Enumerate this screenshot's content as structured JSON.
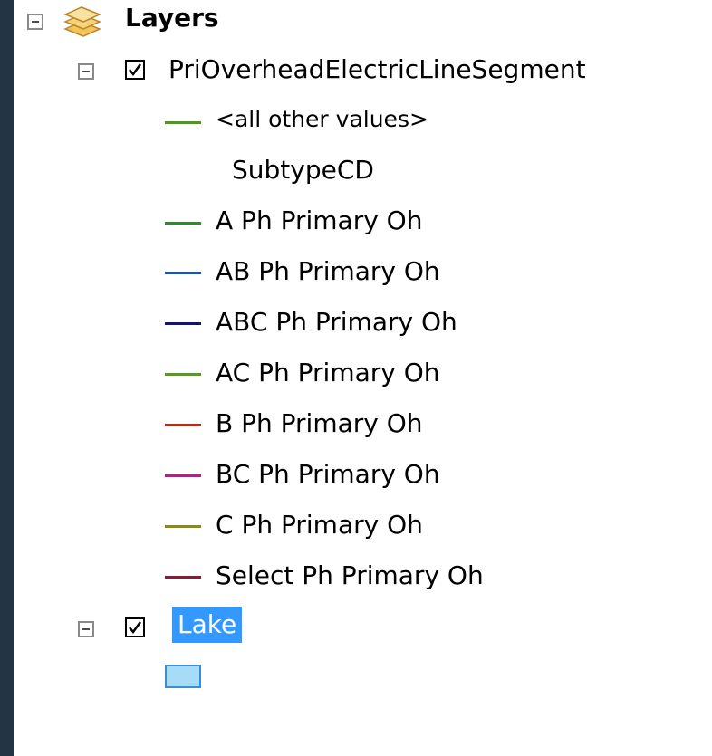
{
  "toc": {
    "root": {
      "label": "Layers",
      "expanded": true,
      "icon": "layers-stack-icon"
    },
    "layers": [
      {
        "label": "PriOverheadElectricLineSegment",
        "checked": true,
        "expanded": true,
        "legend": [
          {
            "label": "<all other values>",
            "color": "#4d9a1a",
            "swatch": "line"
          },
          {
            "label": "SubtypeCD",
            "swatch": "none"
          },
          {
            "label": "A Ph Primary Oh",
            "color": "#2f8a2f",
            "swatch": "line"
          },
          {
            "label": "AB Ph Primary Oh",
            "color": "#1c5aa8",
            "swatch": "line"
          },
          {
            "label": "ABC Ph Primary Oh",
            "color": "#14146e",
            "swatch": "line"
          },
          {
            "label": "AC Ph Primary Oh",
            "color": "#5a9a1a",
            "swatch": "line"
          },
          {
            "label": "B Ph Primary Oh",
            "color": "#b03010",
            "swatch": "line"
          },
          {
            "label": "BC Ph Primary Oh",
            "color": "#b0208a",
            "swatch": "line"
          },
          {
            "label": "C Ph Primary Oh",
            "color": "#8a8a1a",
            "swatch": "line"
          },
          {
            "label": "Select Ph Primary Oh",
            "color": "#8a1a3a",
            "swatch": "line"
          }
        ]
      },
      {
        "label": "Lake",
        "checked": true,
        "expanded": true,
        "selected": true,
        "legend": [
          {
            "label": "",
            "color": "#a6dcf5",
            "swatch": "fill"
          }
        ]
      }
    ]
  },
  "colors": {
    "background": "#233545",
    "selection": "#3399ff"
  }
}
